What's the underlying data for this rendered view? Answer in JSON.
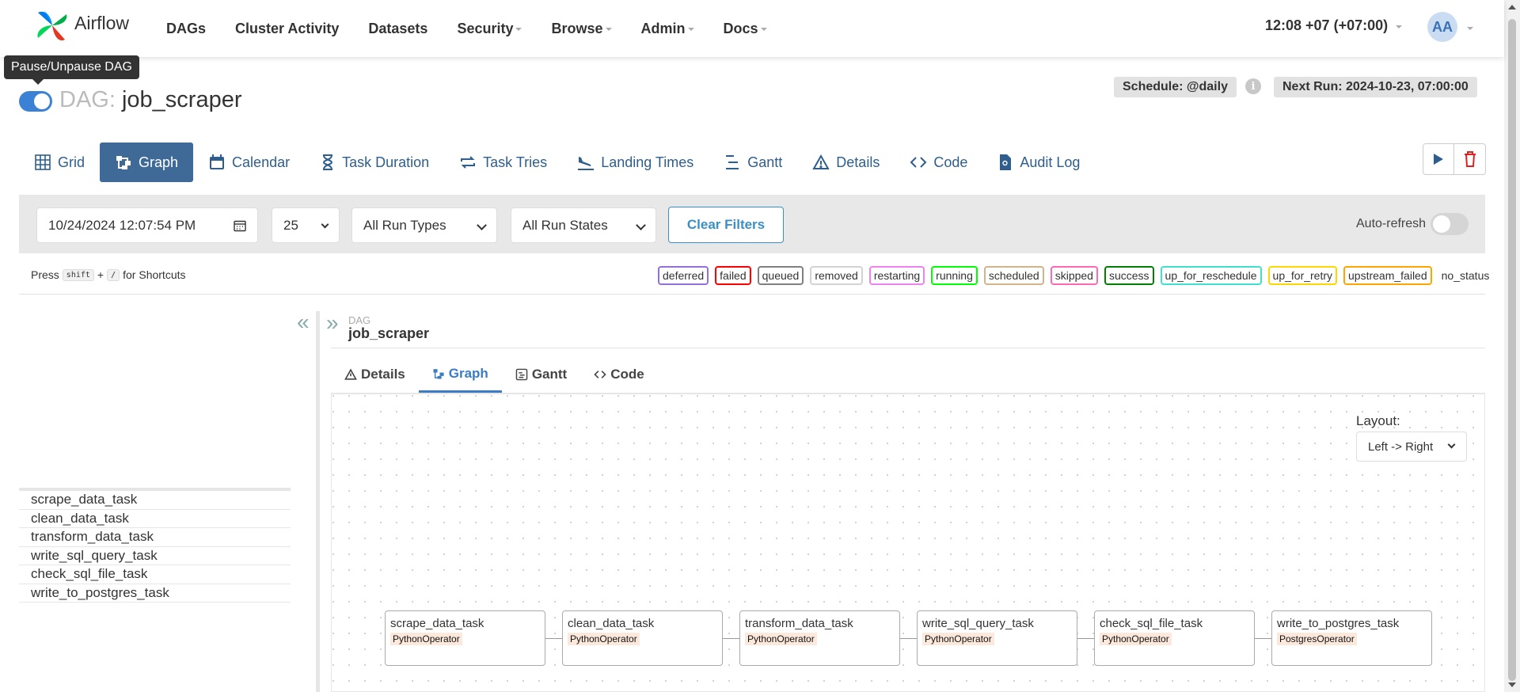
{
  "app": {
    "name": "Airflow"
  },
  "nav": {
    "links": [
      {
        "label": "DAGs",
        "has_dropdown": false
      },
      {
        "label": "Cluster Activity",
        "has_dropdown": false
      },
      {
        "label": "Datasets",
        "has_dropdown": false
      },
      {
        "label": "Security",
        "has_dropdown": true
      },
      {
        "label": "Browse",
        "has_dropdown": true
      },
      {
        "label": "Admin",
        "has_dropdown": true
      },
      {
        "label": "Docs",
        "has_dropdown": true
      }
    ],
    "clock": "12:08 +07 (+07:00)",
    "avatar_initials": "AA"
  },
  "tooltip": "Pause/Unpause DAG",
  "dag": {
    "label": "DAG:",
    "id": "job_scraper",
    "paused": false,
    "schedule": "Schedule: @daily",
    "next_run": "Next Run: 2024-10-23, 07:00:00"
  },
  "view_tabs": [
    {
      "label": "Grid",
      "icon": "grid-icon",
      "active": false
    },
    {
      "label": "Graph",
      "icon": "graph-icon",
      "active": true
    },
    {
      "label": "Calendar",
      "icon": "calendar-icon",
      "active": false
    },
    {
      "label": "Task Duration",
      "icon": "hourglass-icon",
      "active": false
    },
    {
      "label": "Task Tries",
      "icon": "repeat-icon",
      "active": false
    },
    {
      "label": "Landing Times",
      "icon": "plane-landing-icon",
      "active": false
    },
    {
      "label": "Gantt",
      "icon": "gantt-icon",
      "active": false
    },
    {
      "label": "Details",
      "icon": "warning-triangle-icon",
      "active": false
    },
    {
      "label": "Code",
      "icon": "code-icon",
      "active": false
    },
    {
      "label": "Audit Log",
      "icon": "file-search-icon",
      "active": false
    }
  ],
  "filters": {
    "date": "10/24/2024 12:07:54 PM",
    "num_runs": "25",
    "run_types": "All Run Types",
    "run_states": "All Run States",
    "clear_label": "Clear Filters",
    "autorefresh_label": "Auto-refresh",
    "autorefresh_on": false
  },
  "shortcuts": {
    "press": "Press",
    "key1": "shift",
    "plus": "+",
    "key2": "/",
    "suffix": "for Shortcuts"
  },
  "legend": [
    {
      "label": "deferred",
      "color": "#9370db"
    },
    {
      "label": "failed",
      "color": "#ff0000"
    },
    {
      "label": "queued",
      "color": "#808080"
    },
    {
      "label": "removed",
      "color": "#d3d3d3"
    },
    {
      "label": "restarting",
      "color": "#ee82ee"
    },
    {
      "label": "running",
      "color": "#00ff00"
    },
    {
      "label": "scheduled",
      "color": "#d2b48c"
    },
    {
      "label": "skipped",
      "color": "#ff69b4"
    },
    {
      "label": "success",
      "color": "#008000"
    },
    {
      "label": "up_for_reschedule",
      "color": "#40e0d0"
    },
    {
      "label": "up_for_retry",
      "color": "#ffd700"
    },
    {
      "label": "upstream_failed",
      "color": "#ffa500"
    },
    {
      "label": "no_status",
      "color": ""
    }
  ],
  "tasks": [
    "scrape_data_task",
    "clean_data_task",
    "transform_data_task",
    "write_sql_query_task",
    "check_sql_file_task",
    "write_to_postgres_task"
  ],
  "panel": {
    "dag_small": "DAG",
    "dag_name": "job_scraper",
    "subtabs": [
      {
        "label": "Details",
        "icon": "warning-triangle-icon",
        "active": false
      },
      {
        "label": "Graph",
        "icon": "graph-icon",
        "active": true
      },
      {
        "label": "Gantt",
        "icon": "gantt-icon",
        "active": false
      },
      {
        "label": "Code",
        "icon": "code-icon",
        "active": false
      }
    ],
    "layout_label": "Layout:",
    "layout_value": "Left -> Right"
  },
  "graph_nodes": [
    {
      "name": "scrape_data_task",
      "operator": "PythonOperator"
    },
    {
      "name": "clean_data_task",
      "operator": "PythonOperator"
    },
    {
      "name": "transform_data_task",
      "operator": "PythonOperator"
    },
    {
      "name": "write_sql_query_task",
      "operator": "PythonOperator"
    },
    {
      "name": "check_sql_file_task",
      "operator": "PythonOperator"
    },
    {
      "name": "write_to_postgres_task",
      "operator": "PostgresOperator"
    }
  ],
  "colors": {
    "accent": "#3f6a98",
    "link": "#2e5e8e",
    "toggle": "#3b82d6",
    "clear": "#3a8fc7"
  }
}
